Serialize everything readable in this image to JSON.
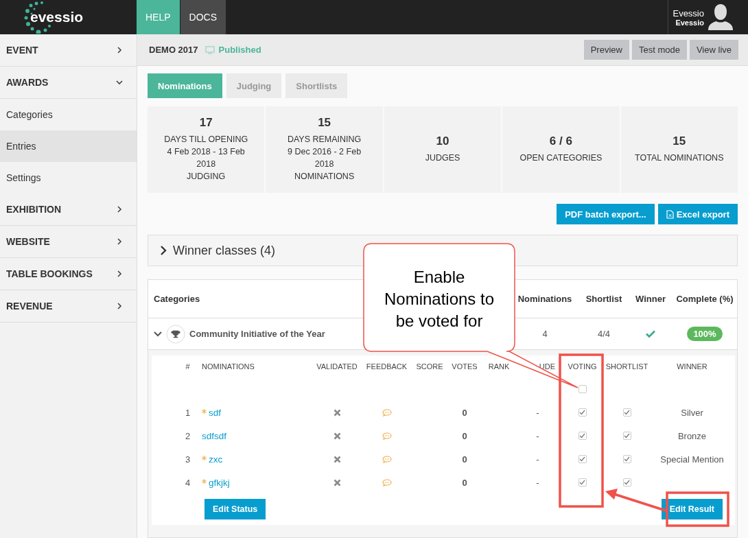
{
  "topbar": {
    "logo": "evessio",
    "nav": [
      {
        "label": "HELP",
        "selected": true
      },
      {
        "label": "DOCS",
        "selected": false
      }
    ],
    "user": {
      "name": "Evessio",
      "org": "Evessio"
    }
  },
  "sidebar": {
    "items": [
      {
        "label": "EVENT",
        "kind": "section",
        "expanded": false,
        "selected": false
      },
      {
        "label": "AWARDS",
        "kind": "section",
        "expanded": true,
        "selected": false
      },
      {
        "label": "Categories",
        "kind": "link",
        "selected": false
      },
      {
        "label": "Entries",
        "kind": "link",
        "selected": true
      },
      {
        "label": "Settings",
        "kind": "link",
        "selected": false
      },
      {
        "label": "EXHIBITION",
        "kind": "section",
        "expanded": false,
        "selected": false
      },
      {
        "label": "WEBSITE",
        "kind": "section",
        "expanded": false,
        "selected": false
      },
      {
        "label": "TABLE BOOKINGS",
        "kind": "section",
        "expanded": false,
        "selected": false
      },
      {
        "label": "REVENUE",
        "kind": "section",
        "expanded": false,
        "selected": false
      }
    ]
  },
  "header": {
    "event": "DEMO 2017",
    "status": "Published",
    "buttons": [
      "Preview",
      "Test mode",
      "View live"
    ]
  },
  "tabs": [
    {
      "label": "Nominations",
      "selected": true
    },
    {
      "label": "Judging",
      "selected": false
    },
    {
      "label": "Shortlists",
      "selected": false
    }
  ],
  "stats": [
    {
      "value": "17",
      "lines": [
        "DAYS TILL OPENING",
        "4 Feb 2018 - 13 Feb 2018",
        "JUDGING"
      ]
    },
    {
      "value": "15",
      "lines": [
        "DAYS REMAINING",
        "9 Dec 2016 - 2 Feb 2018",
        "NOMINATIONS"
      ]
    },
    {
      "value": "10",
      "lines": [
        "JUDGES"
      ]
    },
    {
      "value": "6 / 6",
      "lines": [
        "OPEN CATEGORIES"
      ]
    },
    {
      "value": "15",
      "lines": [
        "TOTAL NOMINATIONS"
      ]
    }
  ],
  "export_buttons": [
    {
      "label": "PDF batch export...",
      "kind": "plain"
    },
    {
      "label": "Excel export",
      "kind": "excel"
    }
  ],
  "winner_classes": {
    "label": "Winner classes (4)",
    "expanded": false
  },
  "categories_table": {
    "columns": [
      "Categories",
      "Nominations",
      "Shortlist",
      "Winner",
      "Complete (%)"
    ],
    "rows": [
      {
        "name": "Community Initiative of the Year",
        "expanded": true,
        "nominations": "4",
        "shortlist": "4/4",
        "has_winner": true,
        "complete": "100%",
        "nominations_table": {
          "columns": [
            "#",
            "NOMINATIONS",
            "VALIDATED",
            "FEEDBACK",
            "SCORE",
            "VOTES",
            "RANK",
            "UDE",
            "VOTING",
            "SHORTLIST",
            "WINNER"
          ],
          "voting_all_checked": false,
          "rows": [
            {
              "number": "1",
              "name": "sdf",
              "starred": true,
              "validated": false,
              "votes": "0",
              "exclude": "-",
              "voting": true,
              "shortlist": true,
              "winner": "Silver"
            },
            {
              "number": "2",
              "name": "sdfsdf",
              "starred": false,
              "validated": false,
              "votes": "0",
              "exclude": "-",
              "voting": true,
              "shortlist": true,
              "winner": "Bronze"
            },
            {
              "number": "3",
              "name": "zxc",
              "starred": true,
              "validated": false,
              "votes": "0",
              "exclude": "-",
              "voting": true,
              "shortlist": true,
              "winner": "Special Mention"
            },
            {
              "number": "4",
              "name": "gfkjkj",
              "starred": true,
              "validated": false,
              "votes": "0",
              "exclude": "-",
              "voting": true,
              "shortlist": true
            }
          ],
          "buttons": [
            "Edit Status",
            "Edit Result"
          ]
        }
      }
    ]
  },
  "annotation": {
    "callout": "Enable Nominations to be voted for"
  }
}
